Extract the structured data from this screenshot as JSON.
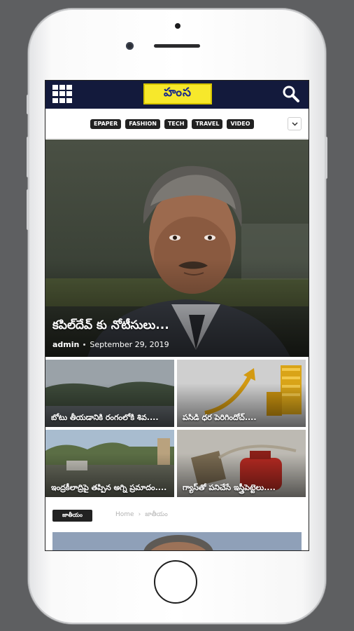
{
  "app": {
    "logo_text": "హంస"
  },
  "categories": [
    "EPAPER",
    "FASHION",
    "TECH",
    "TRAVEL",
    "VIDEO"
  ],
  "hero": {
    "title": "కపిల్‌దేవ్ కు నోటీసులు...",
    "author": "admin",
    "date": "September 29, 2019"
  },
  "tiles": [
    {
      "title": "బోటు తీయడానికి రంగంలోకి శివ...."
    },
    {
      "title": "పసిడి ధర పెరిగిందోచ్...."
    },
    {
      "title": "ఇంద్రకీలాద్రిపై తప్పిన అగ్ని ప్రమాదం...."
    },
    {
      "title": "గ్యాస్‌తో పనిచేసే ఇస్త్రీపెట్టెలు...."
    }
  ],
  "section": {
    "tag": "జాతీయం",
    "breadcrumb_home": "Home",
    "breadcrumb_sep": "›",
    "breadcrumb_current": "జాతీయం"
  },
  "icons": {
    "menu": "grid-menu-icon",
    "search": "search-icon",
    "dropdown": "chevron-down-icon"
  },
  "colors": {
    "topbar": "#131a3c",
    "logo_bg": "#f7e82b",
    "chip_bg": "#222222"
  }
}
